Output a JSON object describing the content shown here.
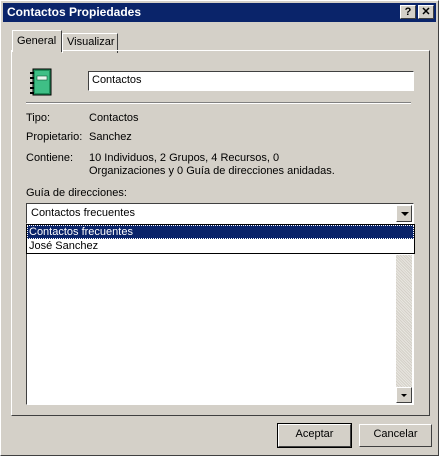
{
  "window": {
    "title": "Contactos Propiedades",
    "help_button": "?",
    "close_button": "✕"
  },
  "tabs": [
    {
      "label": "General",
      "active": true
    },
    {
      "label": "Visualizar",
      "active": false
    }
  ],
  "general": {
    "icon": "address-book-icon",
    "name_value": "Contactos",
    "type_label": "Tipo:",
    "type_value": "Contactos",
    "owner_label": "Propietario:",
    "owner_value": "Sanchez",
    "contains_label": "Contiene:",
    "contains_line1": "10 Individuos, 2 Grupos, 4 Recursos, 0",
    "contains_line2": "Organizaciones y 0 Guía de direcciones anidadas.",
    "address_book_label": "Guía de direcciones:",
    "address_book_selected": "Contactos frecuentes",
    "address_book_options": [
      "Contactos frecuentes",
      "José Sanchez"
    ]
  },
  "buttons": {
    "ok": "Aceptar",
    "cancel": "Cancelar"
  },
  "colors": {
    "titlebar": "#0a246a",
    "face": "#d4d0c8",
    "selection": "#0a246a",
    "icon_green": "#1e8f5a"
  }
}
